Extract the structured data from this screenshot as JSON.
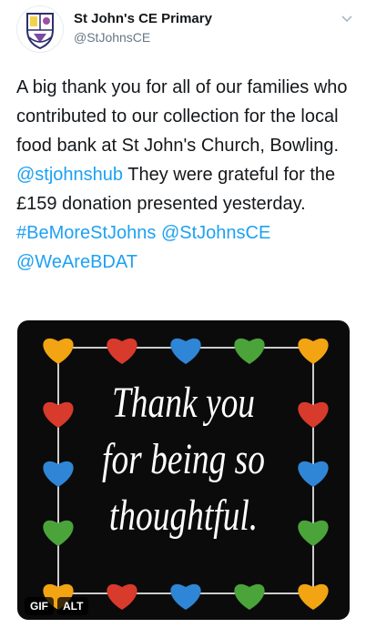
{
  "account": {
    "name": "St John's CE Primary",
    "handle": "@StJohnsCE"
  },
  "tweet": {
    "text_1": "A big thank you for all of our families who contributed to our collection for the local food bank at St John's Church, Bowling. ",
    "mention_1": "@stjohnshub",
    "text_2": " They were grateful for the £159 donation presented yesterday. ",
    "hashtag": "#BeMoreStJohns",
    "mention_2": "@StJohnsCE",
    "mention_3": "@WeAreBDAT"
  },
  "media": {
    "caption_lines": [
      "Thank you",
      "for being so",
      "thoughtful."
    ],
    "gif_badge": "GIF",
    "alt_badge": "ALT",
    "heart_colors": [
      "#f2a413",
      "#d83a2c",
      "#2f86d6",
      "#4aa43a"
    ]
  },
  "icons": {
    "avatar": "school-crest-icon",
    "menu": "chevron-down-icon"
  }
}
